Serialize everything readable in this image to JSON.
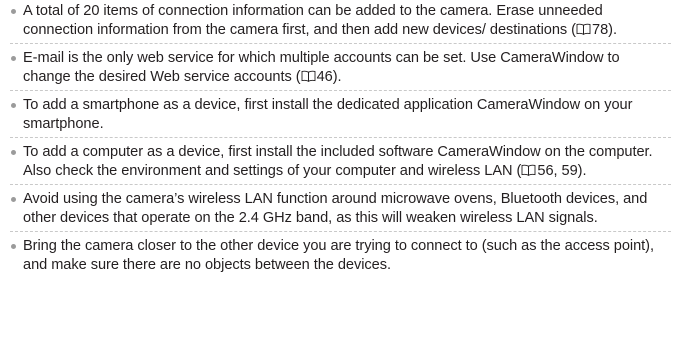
{
  "notes": [
    {
      "parts": [
        {
          "text": "A total of 20 items of connection information can be added to the camera. Erase unneeded connection information from the camera first, and then add new devices/ destinations ("
        },
        {
          "icon": "book-reference-icon"
        },
        {
          "text": "78)."
        }
      ]
    },
    {
      "parts": [
        {
          "text": "E-mail is the only web service for which multiple accounts can be set. Use CameraWindow to change the desired Web service accounts ("
        },
        {
          "icon": "book-reference-icon"
        },
        {
          "text": "46)."
        }
      ]
    },
    {
      "parts": [
        {
          "text": "To add a smartphone as a device, first install the dedicated application CameraWindow on your smartphone."
        }
      ]
    },
    {
      "parts": [
        {
          "text": "To add a computer as a device, first install the included software CameraWindow on the computer. Also check the environment and settings of your computer and wireless LAN ("
        },
        {
          "icon": "book-reference-icon"
        },
        {
          "text": "56, 59)."
        }
      ]
    },
    {
      "parts": [
        {
          "text": "Avoid using the camera’s wireless LAN function around microwave ovens, Bluetooth devices, and other devices that operate on the 2.4 GHz band, as this will weaken wireless LAN signals."
        }
      ]
    },
    {
      "parts": [
        {
          "text": "Bring the camera closer to the other device you are trying to connect to (such as the access point), and make sure there are no objects between the devices."
        }
      ]
    }
  ],
  "colors": {
    "text": "#231f20",
    "bullet": "#9b9b9b",
    "divider": "#c9c9c9"
  }
}
